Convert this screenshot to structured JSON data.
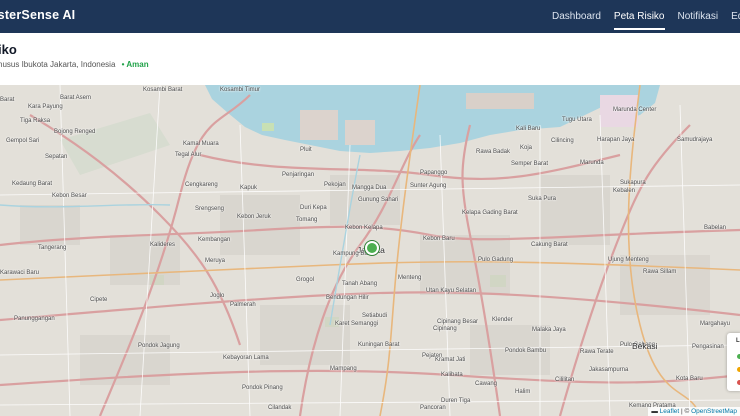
{
  "navbar": {
    "brand": "isterSense AI",
    "links": [
      {
        "label": "Dashboard",
        "active": false
      },
      {
        "label": "Peta Risiko",
        "active": true
      },
      {
        "label": "Notifikasi",
        "active": false
      },
      {
        "label": "Edukasi",
        "active": false
      }
    ]
  },
  "header": {
    "title": "iko",
    "location": "husus Ibukota Jakarta, Indonesia",
    "status": "• Aman",
    "status_color": "#22a34a"
  },
  "map": {
    "labels": [
      {
        "text": "Barat"
      },
      {
        "text": "Kosambi Barat"
      },
      {
        "text": "Kosambi Timur"
      },
      {
        "text": "Kara Payung"
      },
      {
        "text": "Tiga Raksa"
      },
      {
        "text": "Bojong Renged"
      },
      {
        "text": "Gempol Sari"
      },
      {
        "text": "Sepatan"
      },
      {
        "text": "Kedaung Barat"
      },
      {
        "text": "Kebon Besar"
      },
      {
        "text": "Tangerang"
      },
      {
        "text": "Karawaci Baru"
      },
      {
        "text": "Panunggangan"
      },
      {
        "text": "Cipete"
      },
      {
        "text": "Pondok Jagung"
      },
      {
        "text": "Barat Asem"
      },
      {
        "text": "Kamal Muara"
      },
      {
        "text": "Tegal Alur"
      },
      {
        "text": "Cengkareng"
      },
      {
        "text": "Kapuk"
      },
      {
        "text": "Kembangan"
      },
      {
        "text": "Meruya"
      },
      {
        "text": "Joglo"
      },
      {
        "text": "Kalideres"
      },
      {
        "text": "Penjaringan"
      },
      {
        "text": "Pluit"
      },
      {
        "text": "Pekojan"
      },
      {
        "text": "Mangga Dua"
      },
      {
        "text": "Gunung Sahari"
      },
      {
        "text": "Sunter Agung"
      },
      {
        "text": "Papanggo"
      },
      {
        "text": "Kebon Kelapa"
      },
      {
        "text": "Jakarta",
        "big": true
      },
      {
        "text": "Kampung Bali"
      },
      {
        "text": "Tanah Abang"
      },
      {
        "text": "Setiabudi"
      },
      {
        "text": "Menteng"
      },
      {
        "text": "Palmerah"
      },
      {
        "text": "Bendungan Hilir"
      },
      {
        "text": "Karet Semanggi"
      },
      {
        "text": "Kuningan Barat"
      },
      {
        "text": "Kebayoran Lama"
      },
      {
        "text": "Mampang"
      },
      {
        "text": "Pondok Pinang"
      },
      {
        "text": "Cilandak"
      },
      {
        "text": "Pejaten"
      },
      {
        "text": "Kebon Baru"
      },
      {
        "text": "Cipinang"
      },
      {
        "text": "Utan Kayu Selatan"
      },
      {
        "text": "Kelapa Gading Barat"
      },
      {
        "text": "Rawa Badak"
      },
      {
        "text": "Semper Barat"
      },
      {
        "text": "Cilincing"
      },
      {
        "text": "Marunda"
      },
      {
        "text": "Suka Pura"
      },
      {
        "text": "Cakung Barat"
      },
      {
        "text": "Pulo Gadung"
      },
      {
        "text": "Klender"
      },
      {
        "text": "Malaka Jaya"
      },
      {
        "text": "Pondok Bambu"
      },
      {
        "text": "Cipinang Besar"
      },
      {
        "text": "Rawa Terate"
      },
      {
        "text": "Pulo Gebang"
      },
      {
        "text": "Ujung Menteng"
      },
      {
        "text": "Rawa Sillam"
      },
      {
        "text": "Jakasampurna"
      },
      {
        "text": "Bekasi",
        "big": true
      },
      {
        "text": "Babelan"
      },
      {
        "text": "Harapan Jaya"
      },
      {
        "text": "Kali Baru"
      },
      {
        "text": "Koja"
      },
      {
        "text": "Tugu Utara"
      },
      {
        "text": "Marunda Center"
      },
      {
        "text": "Samudrajaya"
      },
      {
        "text": "Sukapura"
      },
      {
        "text": "Kebalen"
      },
      {
        "text": "Margahayu"
      },
      {
        "text": "Pengasinan"
      },
      {
        "text": "Kemang Pratama"
      },
      {
        "text": "Kota Baru"
      },
      {
        "text": "Duri Kepa"
      },
      {
        "text": "Srengseng"
      },
      {
        "text": "Kebon Jeruk"
      },
      {
        "text": "Tomang"
      },
      {
        "text": "Grogol"
      },
      {
        "text": "Kalibata"
      },
      {
        "text": "Duren Tiga"
      },
      {
        "text": "Pancoran"
      },
      {
        "text": "Cawang"
      },
      {
        "text": "Halim"
      },
      {
        "text": "Kramat Jati"
      },
      {
        "text": "Cililitan"
      }
    ],
    "attribution_leaflet": "Leaflet",
    "attribution_sep": " | © ",
    "attribution_osm": "OpenStreetMap",
    "legend_letter": "L",
    "legend_colors": [
      "#4caf50",
      "#f0a500",
      "#d9534f"
    ]
  }
}
